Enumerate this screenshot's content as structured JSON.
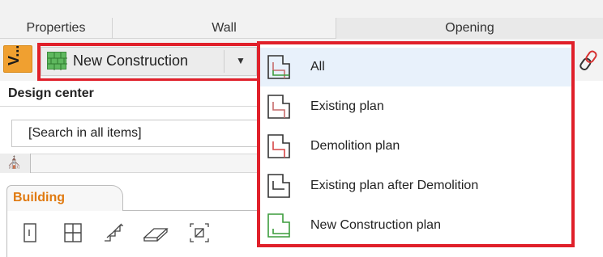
{
  "ribbon": {
    "tabs": [
      {
        "label": "Properties"
      },
      {
        "label": "Wall"
      },
      {
        "label": "Opening"
      }
    ]
  },
  "toolbar": {
    "v_button_label": "V...",
    "phase_combo": {
      "selected": "New Construction",
      "swatch_color": "#5fb85f"
    }
  },
  "design_center": {
    "title": "Design center",
    "search_placeholder": "[Search in all items]",
    "active_tab": "Building",
    "tool_icons": [
      "door-icon",
      "window-icon",
      "stair-icon",
      "slab-icon",
      "zone-icon"
    ]
  },
  "dropdown": {
    "highlight_color": "#e0202a",
    "items": [
      {
        "label": "All",
        "icon": "plan-all-icon"
      },
      {
        "label": "Existing plan",
        "icon": "plan-existing-icon"
      },
      {
        "label": "Demolition plan",
        "icon": "plan-demolition-icon"
      },
      {
        "label": "Existing plan after Demolition",
        "icon": "plan-existing-after-demolition-icon"
      },
      {
        "label": "New Construction plan",
        "icon": "plan-new-construction-icon"
      }
    ]
  }
}
